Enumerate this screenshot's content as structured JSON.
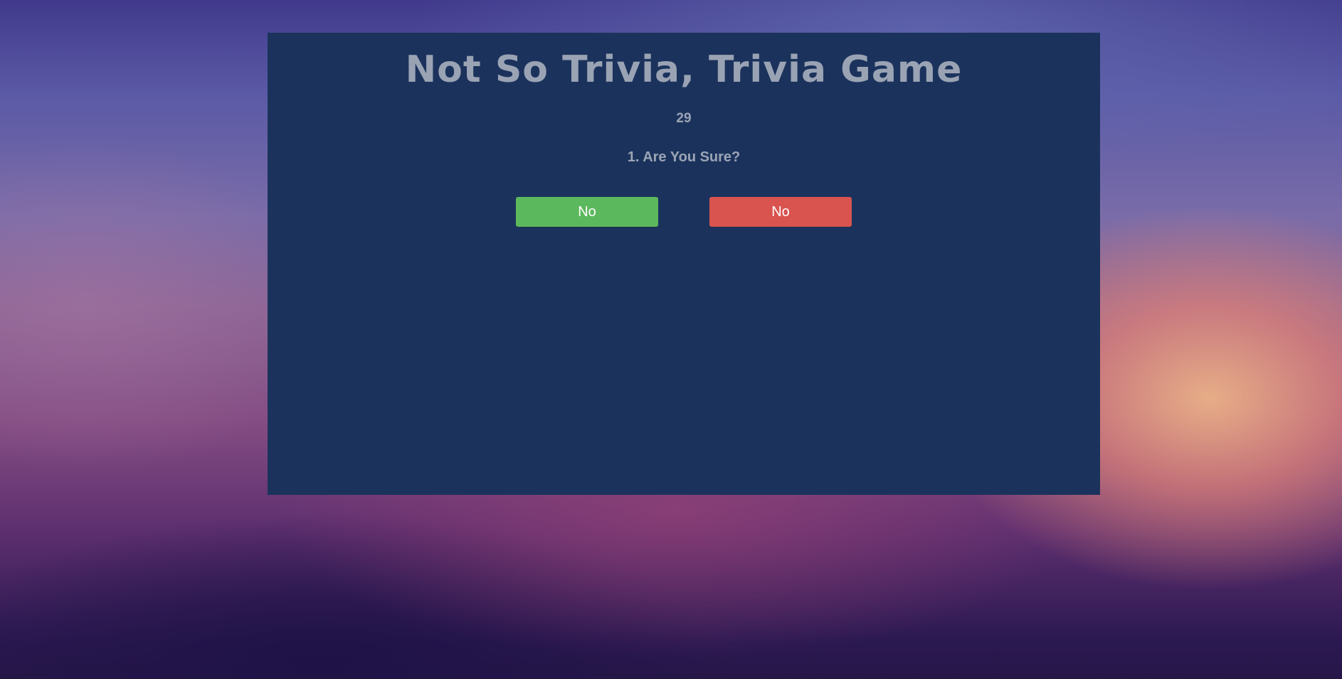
{
  "game": {
    "title": "Not So Trivia, Trivia Game",
    "timer": "29",
    "question": "1. Are You Sure?",
    "answers": [
      {
        "label": "No",
        "color": "#5cb85c"
      },
      {
        "label": "No",
        "color": "#d9534f"
      }
    ]
  },
  "colors": {
    "panel_background": "#1b335c",
    "text": "#9ba4b5",
    "button_text": "#ffffff"
  }
}
